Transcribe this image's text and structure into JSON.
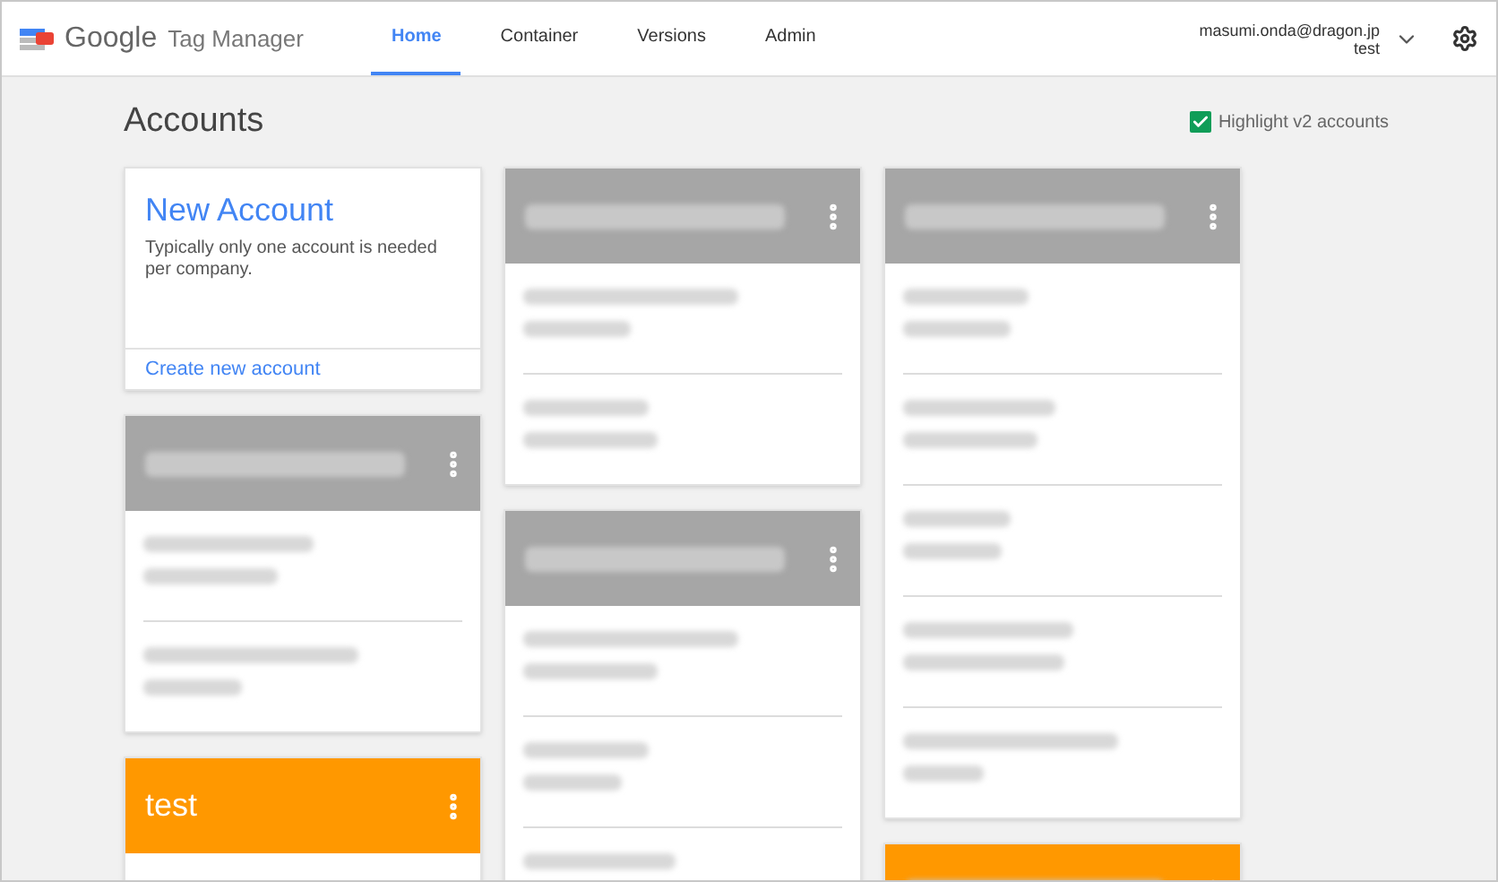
{
  "header": {
    "logo_google": "Google",
    "logo_product": "Tag Manager",
    "tabs": [
      {
        "label": "Home",
        "selected": true
      },
      {
        "label": "Container",
        "selected": false
      },
      {
        "label": "Versions",
        "selected": false
      },
      {
        "label": "Admin",
        "selected": false
      }
    ],
    "user": {
      "email": "masumi.onda@dragon.jp",
      "account": "test"
    }
  },
  "page": {
    "title": "Accounts",
    "highlight_v2": {
      "label": "Highlight v2 accounts",
      "checked": true
    }
  },
  "columns": [
    {
      "cards": [
        {
          "kind": "new",
          "title": "New Account",
          "description": "Typically only one account is needed per company.",
          "link": "Create new account"
        },
        {
          "kind": "account",
          "title_blurred": true,
          "color": "#a6a6a6",
          "sections": [
            {
              "blurred": true
            },
            {
              "blurred": true
            }
          ]
        },
        {
          "kind": "account",
          "title": "test",
          "title_blurred": false,
          "color": "#ff9800"
        }
      ]
    },
    {
      "cards": [
        {
          "kind": "account",
          "title_blurred": true,
          "color": "#a6a6a6",
          "sections": [
            {
              "blurred": true
            },
            {
              "blurred": true
            }
          ]
        },
        {
          "kind": "account",
          "title_blurred": true,
          "color": "#a6a6a6",
          "sections": [
            {
              "blurred": true
            },
            {
              "blurred": true
            },
            {
              "blurred": true
            }
          ]
        }
      ]
    },
    {
      "cards": [
        {
          "kind": "account",
          "title_blurred": true,
          "color": "#a6a6a6",
          "sections": [
            {
              "blurred": true
            },
            {
              "blurred": true
            },
            {
              "blurred": true
            },
            {
              "blurred": true
            },
            {
              "blurred": true
            }
          ]
        },
        {
          "kind": "account",
          "title_blurred": true,
          "color": "#ff9800"
        }
      ]
    }
  ]
}
